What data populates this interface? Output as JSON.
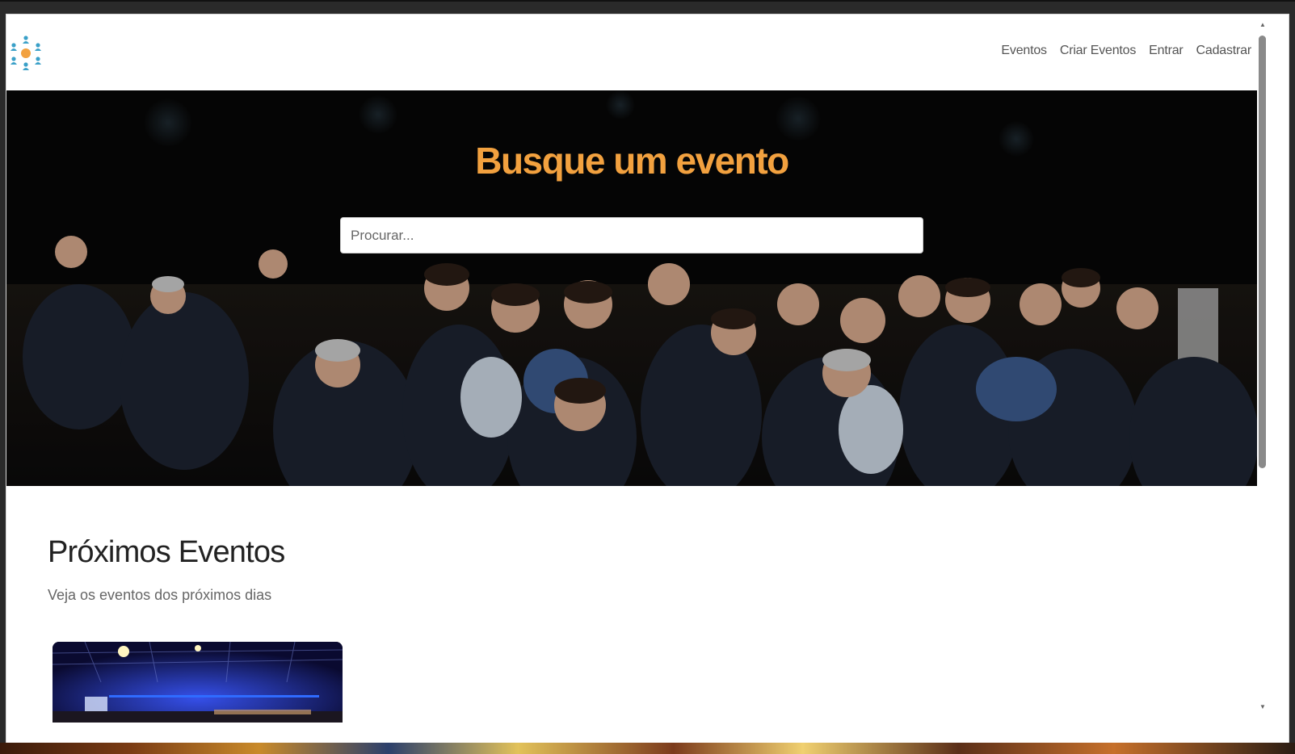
{
  "navbar": {
    "logo": "people-network-logo",
    "links": [
      "Eventos",
      "Criar Eventos",
      "Entrar",
      "Cadastrar"
    ]
  },
  "hero": {
    "title": "Busque um evento",
    "search_placeholder": "Procurar...",
    "image": "audience-seated-at-conference",
    "title_color": "#f2a13f"
  },
  "events": {
    "title": "Próximos Eventos",
    "subtitle": "Veja os eventos dos próximos dias",
    "cards": [
      {
        "image": "concert-hall-blue-lights"
      }
    ]
  }
}
